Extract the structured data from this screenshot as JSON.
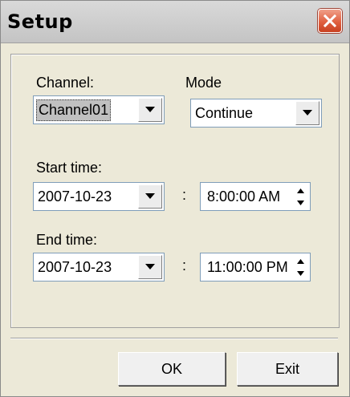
{
  "window": {
    "title": "Setup"
  },
  "channel": {
    "label": "Channel:",
    "value": "Channel01"
  },
  "mode": {
    "label": "Mode",
    "value": "Continue"
  },
  "start": {
    "label": "Start time:",
    "date": "2007-10-23",
    "separator": ":",
    "time": "8:00:00 AM"
  },
  "end": {
    "label": "End time:",
    "date": "2007-10-23",
    "separator": ":",
    "time": "11:00:00 PM"
  },
  "buttons": {
    "ok": "OK",
    "exit": "Exit"
  },
  "colors": {
    "close_button": "#e06040",
    "face": "#ece9d8",
    "input_border": "#7f9db9"
  },
  "icons": {
    "close": "close-icon",
    "dropdown": "chevron-down-icon",
    "spin_up": "spin-up-icon",
    "spin_down": "spin-down-icon"
  }
}
